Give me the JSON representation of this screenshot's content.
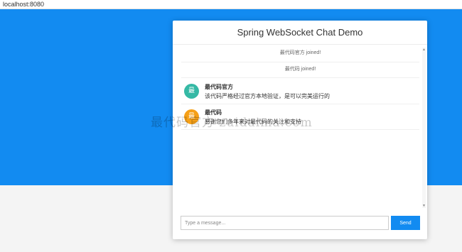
{
  "browser": {
    "url": "localhost:8080"
  },
  "colors": {
    "primary": "#128bf1",
    "avatar_teal": "#35b9a5",
    "avatar_orange": "#f6a017"
  },
  "chat": {
    "title": "Spring WebSocket Chat Demo",
    "events": [
      {
        "text": "最代码官方 joined!"
      },
      {
        "text": "最代码 joined!"
      }
    ],
    "messages": [
      {
        "avatar_letter": "最",
        "avatar_color": "#35b9a5",
        "sender": "最代码官方",
        "text": "该代码严格经过官方本地验证，是可以完美运行的"
      },
      {
        "avatar_letter": "最",
        "avatar_color": "#f6a017",
        "sender": "最代码",
        "text": "感谢您们多年来对最代码的关注和支持"
      }
    ],
    "input": {
      "placeholder": "Type a message...",
      "value": ""
    },
    "send_label": "Send"
  },
  "watermark": {
    "text": "最代码官方 zuidaima.com"
  },
  "icons": {
    "scroll_up": "triangle-up",
    "scroll_down": "triangle-down"
  }
}
